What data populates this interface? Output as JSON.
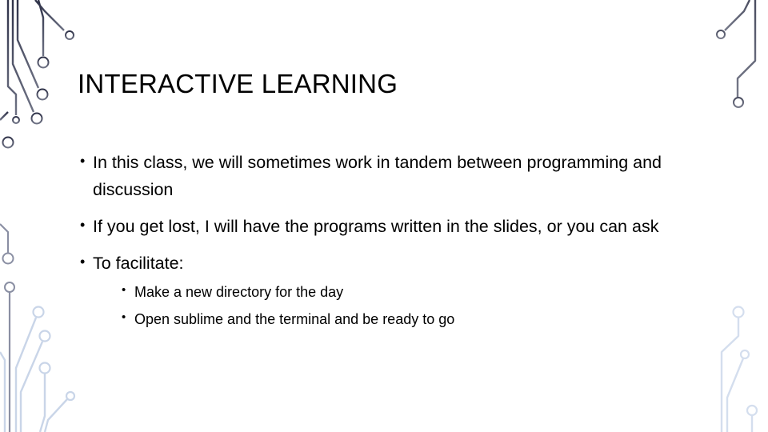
{
  "slide": {
    "title": "INTERACTIVE LEARNING",
    "bullets": [
      {
        "text": "In this class, we will sometimes work in tandem between programming and discussion"
      },
      {
        "text": "If you get lost, I will have the programs written in the slides, or you can ask"
      },
      {
        "text": "To facilitate:",
        "subbullets": [
          {
            "text": "Make a new directory for the day"
          },
          {
            "text": "Open sublime and the terminal and be ready to go"
          }
        ]
      }
    ],
    "bullet_glyph": "•"
  },
  "theme": {
    "circuit_dark": "#3b3e52",
    "circuit_mid": "#6e7284",
    "circuit_light": "#c9d5e8",
    "text_color": "#000000",
    "background": "#ffffff"
  }
}
